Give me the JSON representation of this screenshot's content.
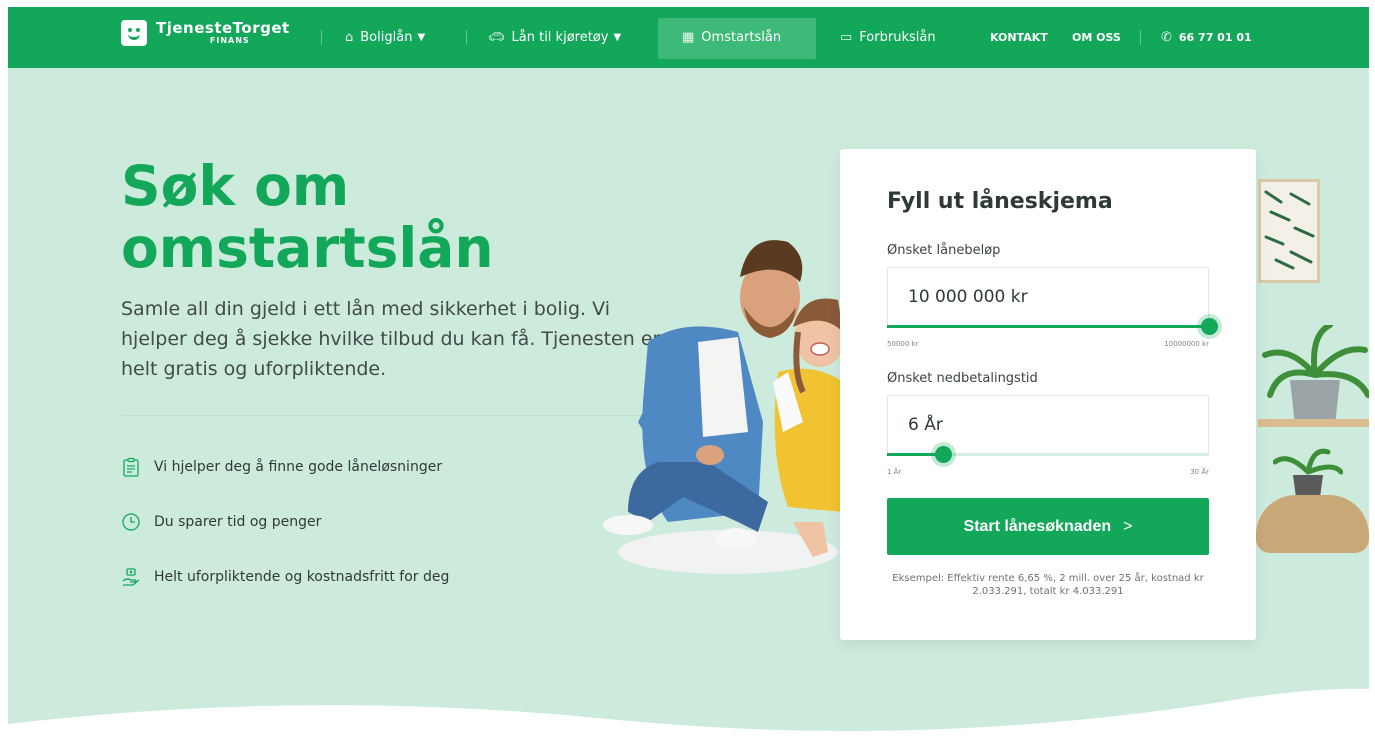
{
  "nav": {
    "logo_main": "TjenesteTorget",
    "logo_sub": "FINANS",
    "items": [
      {
        "label": "Boliglån",
        "icon": "house-icon",
        "dropdown": true
      },
      {
        "label": "Lån til kjøretøy",
        "icon": "car-icon",
        "dropdown": true
      },
      {
        "label": "Omstartslån",
        "icon": "calendar-icon",
        "active": true
      },
      {
        "label": "Forbrukslån",
        "icon": "card-icon"
      }
    ],
    "contact": "KONTAKT",
    "about": "OM OSS",
    "phone": "66 77 01 01",
    "phone_icon": "phone-icon"
  },
  "hero": {
    "title_line1": "Søk om",
    "title_line2": "omstartslån",
    "description": "Samle all din gjeld i ett lån med sikkerhet i bolig. Vi hjelper deg å sjekke hvilke tilbud du kan få. Tjenesten er helt gratis og uforpliktende.",
    "features": [
      {
        "text": "Vi hjelper deg å finne gode låneløsninger",
        "icon": "clipboard-icon"
      },
      {
        "text": "Du sparer tid og penger",
        "icon": "clock-icon"
      },
      {
        "text": "Helt uforpliktende og kostnadsfritt for deg",
        "icon": "money-hand-icon"
      }
    ]
  },
  "form": {
    "title": "Fyll ut låneskjema",
    "amount": {
      "label": "Ønsket lånebeløp",
      "value": "10 000 000 kr",
      "min_label": "50000 kr",
      "max_label": "10000000 kr",
      "fraction": 1.0
    },
    "term": {
      "label": "Ønsket nedbetalingstid",
      "value": "6 År",
      "min_label": "1 År",
      "max_label": "30 År",
      "fraction": 0.1724
    },
    "submit_label": "Start lånesøknaden",
    "submit_arrow": ">",
    "example": "Eksempel: Effektiv rente 6,65 %, 2 mill. over 25 år, kostnad kr 2.033.291, totalt kr 4.033.291"
  },
  "colors": {
    "brand": "#13a75a",
    "hero_bg": "#cdebdc"
  }
}
